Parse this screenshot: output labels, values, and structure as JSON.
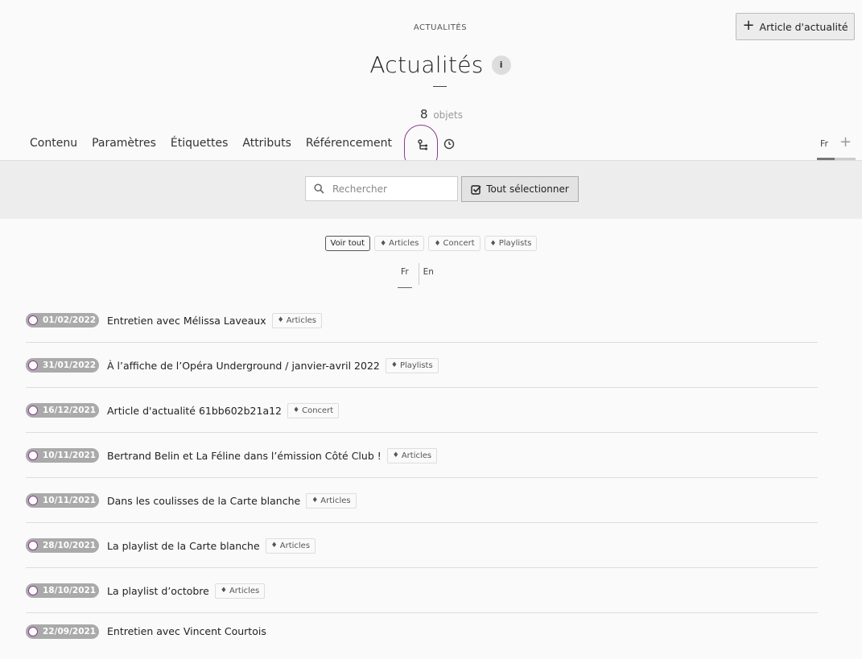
{
  "header": {
    "breadcrumb": "ACTUALITÉS",
    "add_button_label": "Article d'actualité",
    "title": "Actualités",
    "info_label": "i",
    "count": "8",
    "count_unit": "objets"
  },
  "tabs": [
    {
      "label": "Contenu"
    },
    {
      "label": "Paramètres"
    },
    {
      "label": "Étiquettes"
    },
    {
      "label": "Attributs"
    },
    {
      "label": "Référencement"
    }
  ],
  "icon_tabs": [
    "tree-icon",
    "clock-icon"
  ],
  "content_lang": {
    "current": "Fr",
    "add": "+"
  },
  "toolbar": {
    "search_placeholder": "Rechercher",
    "select_all_label": "Tout sélectionner"
  },
  "filters": [
    {
      "label": "Voir tout",
      "active": true
    },
    {
      "label": "Articles",
      "active": false
    },
    {
      "label": "Concert",
      "active": false
    },
    {
      "label": "Playlists",
      "active": false
    }
  ],
  "lang_tabs": [
    {
      "label": "Fr",
      "active": true
    },
    {
      "label": "En",
      "active": false
    }
  ],
  "items": [
    {
      "date": "01/02/2022",
      "title": "Entretien avec Mélissa Laveaux",
      "tag": "Articles"
    },
    {
      "date": "31/01/2022",
      "title": "À l’affiche de l’Opéra Underground / janvier-avril 2022",
      "tag": "Playlists"
    },
    {
      "date": "16/12/2021",
      "title": "Article d'actualité 61bb602b21a12",
      "tag": "Concert"
    },
    {
      "date": "10/11/2021",
      "title": "Bertrand Belin et La Féline dans l’émission Côté Club !",
      "tag": "Articles"
    },
    {
      "date": "10/11/2021",
      "title": "Dans les coulisses de la Carte blanche",
      "tag": "Articles"
    },
    {
      "date": "28/10/2021",
      "title": "La playlist de la Carte blanche",
      "tag": "Articles"
    },
    {
      "date": "18/10/2021",
      "title": "La playlist d’octobre",
      "tag": "Articles"
    },
    {
      "date": "22/09/2021",
      "title": "Entretien avec Vincent Courtois",
      "tag": ""
    }
  ],
  "colors": {
    "accent": "#8a3b8f",
    "badge": "#aaaaaa",
    "toolbar_bg": "#ededed"
  }
}
